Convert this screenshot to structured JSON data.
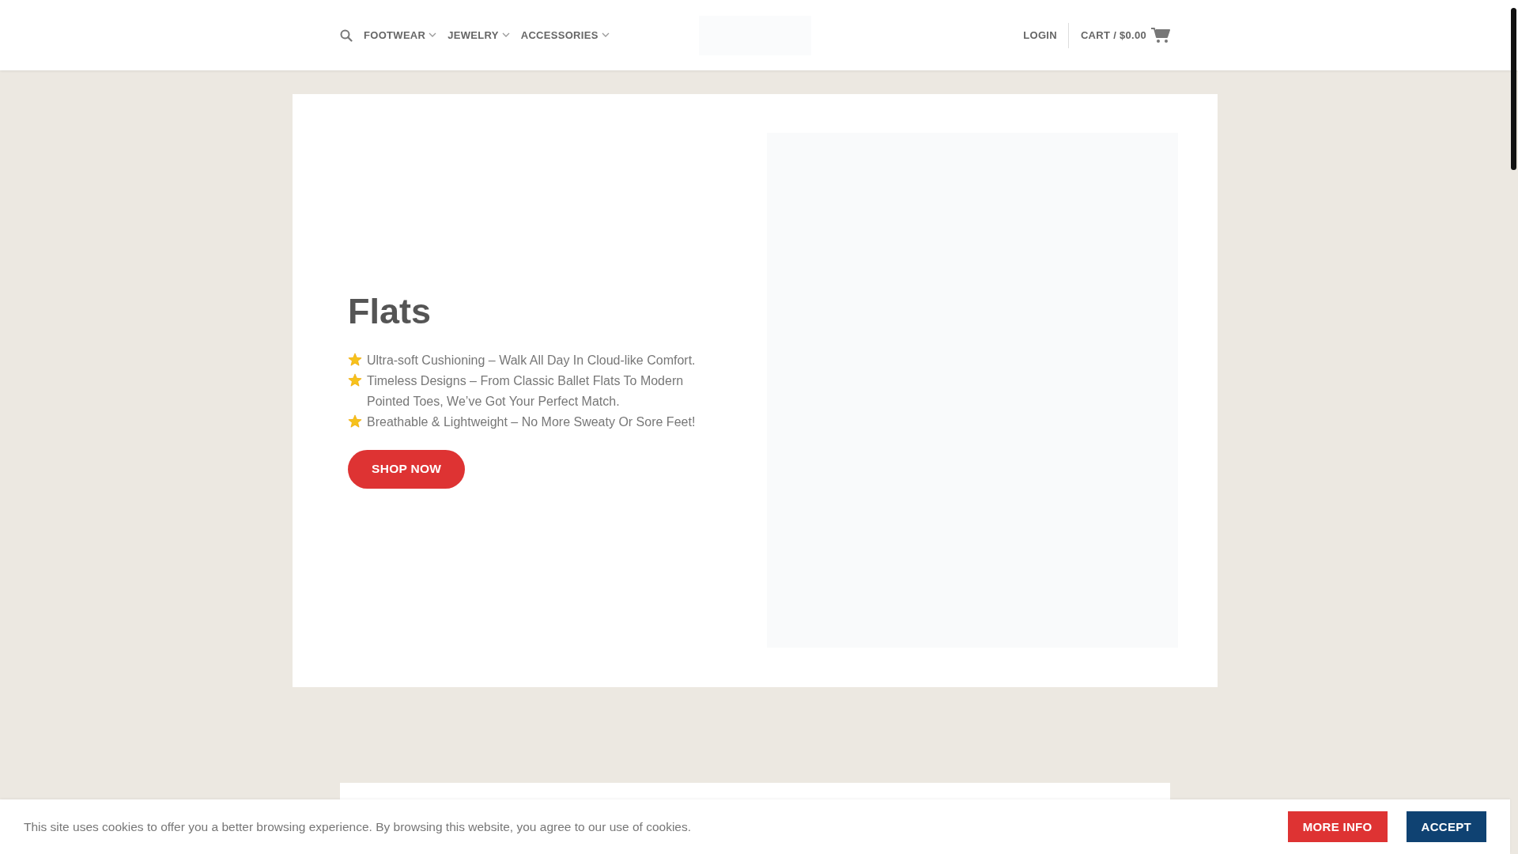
{
  "header": {
    "nav": [
      {
        "label": "FOOTWEAR",
        "has_dropdown": true
      },
      {
        "label": "JEWELRY",
        "has_dropdown": true
      },
      {
        "label": "ACCESSORIES",
        "has_dropdown": true
      }
    ],
    "login": "LOGIN",
    "cart": "CART / $0.00"
  },
  "hero": {
    "title": "Flats",
    "bullets": [
      "Ultra-soft Cushioning – Walk All Day In Cloud-like Comfort.",
      "Timeless Designs – From Classic Ballet Flats To Modern Pointed Toes, We’ve Got Your Perfect Match.",
      "Breathable & Lightweight – No More Sweaty Or Sore Feet!"
    ],
    "button": "SHOP NOW"
  },
  "cookie_bar": {
    "message": "This site uses cookies to offer you a better browsing experience. By browsing this website, you agree to our use of cookies.",
    "buttons": [
      {
        "label": "MORE INFO",
        "kind": "info"
      },
      {
        "label": "ACCEPT",
        "kind": "accept"
      }
    ]
  }
}
